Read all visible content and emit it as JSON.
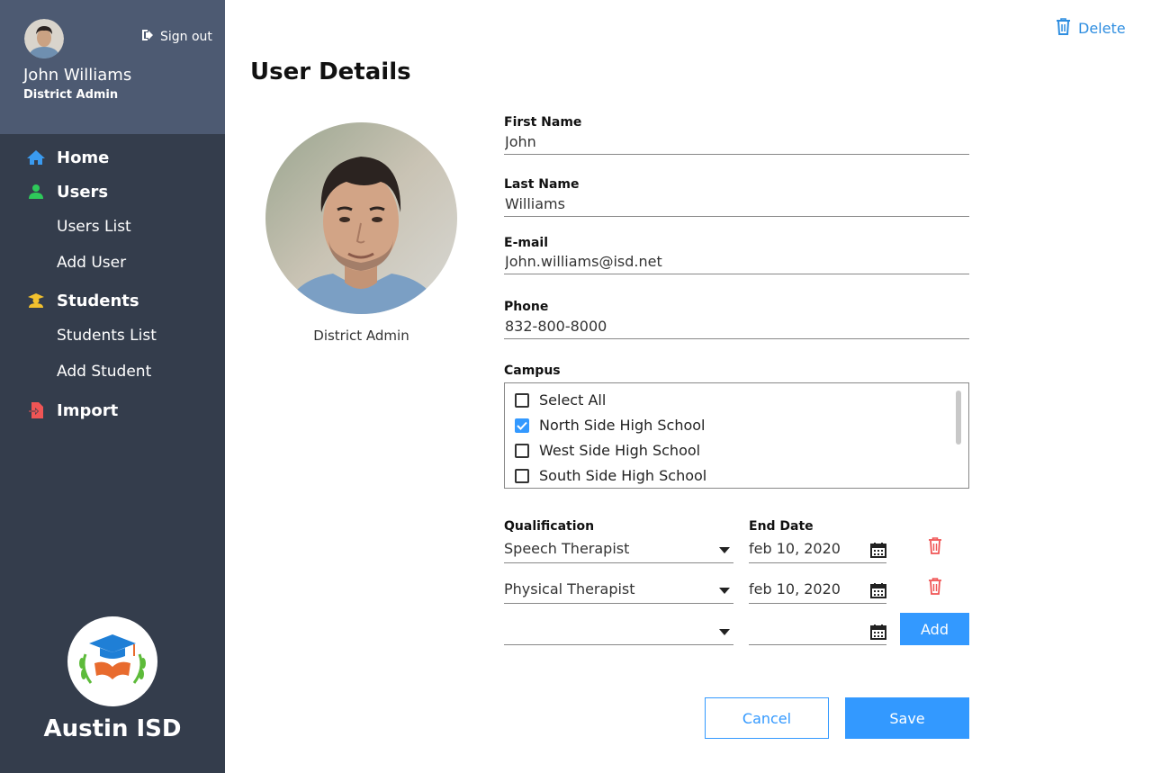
{
  "sidebar": {
    "user_name": "John Williams",
    "user_role": "District Admin",
    "signout_label": "Sign out",
    "nav": {
      "home": "Home",
      "users": "Users",
      "users_list": "Users List",
      "add_user": "Add User",
      "students": "Students",
      "students_list": "Students List",
      "add_student": "Add Student",
      "import": "Import"
    },
    "district_name": "Austin ISD"
  },
  "header": {
    "delete_label": "Delete",
    "page_title": "User Details"
  },
  "profile": {
    "role": "District Admin"
  },
  "form": {
    "first_name": {
      "label": "First Name",
      "value": "John"
    },
    "last_name": {
      "label": "Last Name",
      "value": "Williams"
    },
    "email": {
      "label": "E-mail",
      "value": "John.williams@isd.net"
    },
    "phone": {
      "label": "Phone",
      "value": "832-800-8000"
    },
    "campus": {
      "label": "Campus",
      "items": [
        {
          "label": "Select All",
          "checked": false
        },
        {
          "label": "North Side High School",
          "checked": true
        },
        {
          "label": "West Side High School",
          "checked": false
        },
        {
          "label": "South Side High School",
          "checked": false
        }
      ]
    },
    "qualification_label": "Qualification",
    "end_date_label": "End Date",
    "qualifications": [
      {
        "qualification": "Speech Therapist",
        "end_date": "feb 10, 2020"
      },
      {
        "qualification": "Physical Therapist",
        "end_date": "feb 10, 2020"
      },
      {
        "qualification": "",
        "end_date": ""
      }
    ],
    "add_label": "Add"
  },
  "actions": {
    "cancel_label": "Cancel",
    "save_label": "Save"
  },
  "colors": {
    "sidebar_bg": "#343d4c",
    "sidebar_header_bg": "#4d5a72",
    "accent": "#3399ff",
    "danger": "#f05555",
    "home_icon": "#3a9bf0",
    "users_icon": "#2ec95a",
    "students_icon": "#f2c12e",
    "import_icon": "#f05555"
  }
}
